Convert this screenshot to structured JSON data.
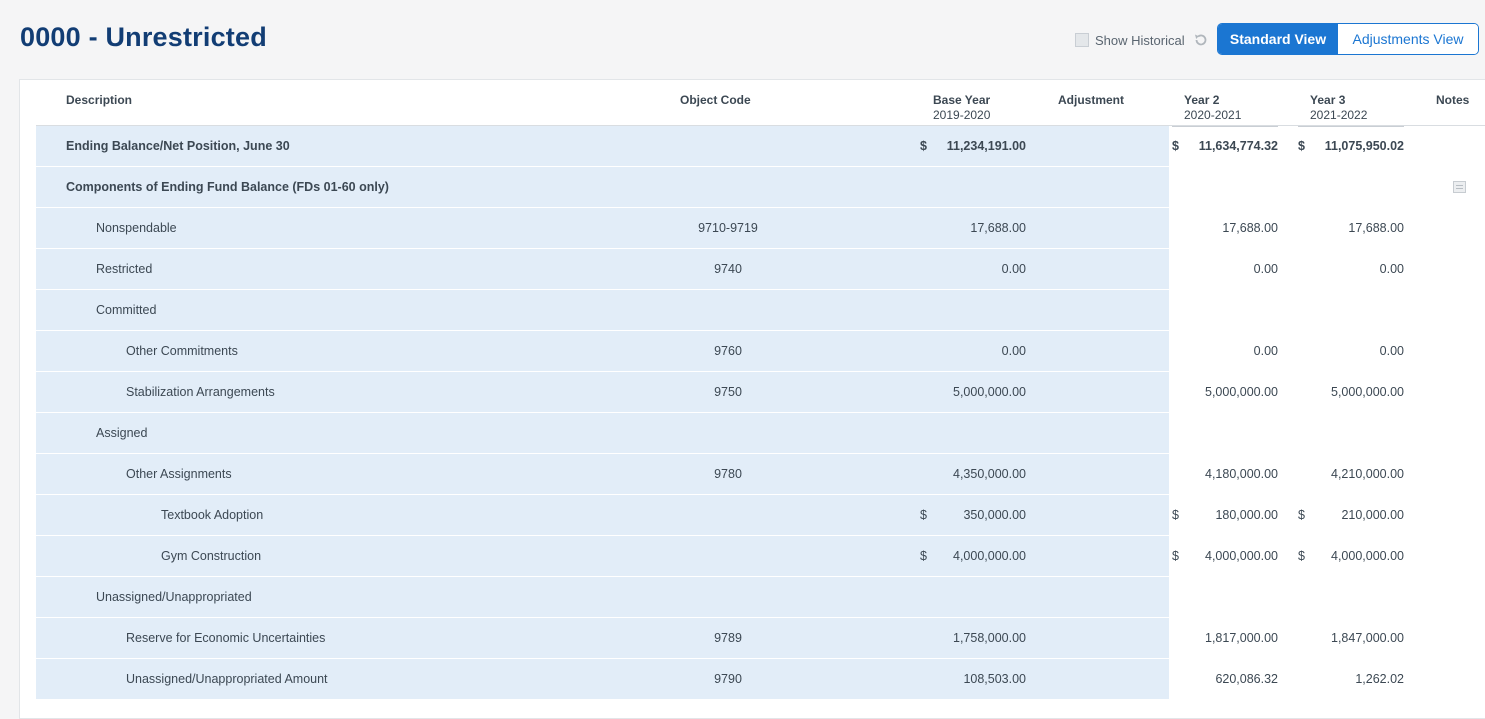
{
  "page": {
    "title": "0000 - Unrestricted"
  },
  "toolbar": {
    "show_historical_label": "Show Historical",
    "standard_view_label": "Standard View",
    "adjustments_view_label": "Adjustments View",
    "active_view": "Standard View"
  },
  "colors": {
    "accent": "#1b76d2",
    "title": "#123d74",
    "row_bg": "#e2edf8"
  },
  "table": {
    "headers": {
      "description": "Description",
      "object_code": "Object Code",
      "base_year": "Base Year",
      "base_year_range": "2019-2020",
      "adjustment": "Adjustment",
      "year2": "Year 2",
      "year2_range": "2020-2021",
      "year3": "Year 3",
      "year3_range": "2021-2022",
      "notes": "Notes"
    },
    "rows": [
      {
        "description": "Ending Balance/Net Position, June 30",
        "code": "",
        "base": "11,234,191.00",
        "year2": "11,634,774.32",
        "year3": "11,075,950.02",
        "dollar_base": "$",
        "dollar_y2": "$",
        "dollar_y3": "$"
      },
      {
        "description": "Components of Ending Fund Balance (FDs 01-60 only)",
        "code": "",
        "base": "",
        "year2": "",
        "year3": "",
        "dollar_base": "",
        "dollar_y2": "",
        "dollar_y3": ""
      },
      {
        "description": "Nonspendable",
        "code": "9710-9719",
        "base": "17,688.00",
        "year2": "17,688.00",
        "year3": "17,688.00",
        "dollar_base": "",
        "dollar_y2": "",
        "dollar_y3": ""
      },
      {
        "description": "Restricted",
        "code": "9740",
        "base": "0.00",
        "year2": "0.00",
        "year3": "0.00",
        "dollar_base": "",
        "dollar_y2": "",
        "dollar_y3": ""
      },
      {
        "description": "Committed",
        "code": "",
        "base": "",
        "year2": "",
        "year3": "",
        "dollar_base": "",
        "dollar_y2": "",
        "dollar_y3": ""
      },
      {
        "description": "Other Commitments",
        "code": "9760",
        "base": "0.00",
        "year2": "0.00",
        "year3": "0.00",
        "dollar_base": "",
        "dollar_y2": "",
        "dollar_y3": ""
      },
      {
        "description": "Stabilization Arrangements",
        "code": "9750",
        "base": "5,000,000.00",
        "year2": "5,000,000.00",
        "year3": "5,000,000.00",
        "dollar_base": "",
        "dollar_y2": "",
        "dollar_y3": ""
      },
      {
        "description": "Assigned",
        "code": "",
        "base": "",
        "year2": "",
        "year3": "",
        "dollar_base": "",
        "dollar_y2": "",
        "dollar_y3": ""
      },
      {
        "description": "Other Assignments",
        "code": "9780",
        "base": "4,350,000.00",
        "year2": "4,180,000.00",
        "year3": "4,210,000.00",
        "dollar_base": "",
        "dollar_y2": "",
        "dollar_y3": ""
      },
      {
        "description": "Textbook Adoption",
        "code": "",
        "base": "350,000.00",
        "year2": "180,000.00",
        "year3": "210,000.00",
        "dollar_base": "$",
        "dollar_y2": "$",
        "dollar_y3": "$"
      },
      {
        "description": "Gym Construction",
        "code": "",
        "base": "4,000,000.00",
        "year2": "4,000,000.00",
        "year3": "4,000,000.00",
        "dollar_base": "$",
        "dollar_y2": "$",
        "dollar_y3": "$"
      },
      {
        "description": "Unassigned/Unappropriated",
        "code": "",
        "base": "",
        "year2": "",
        "year3": "",
        "dollar_base": "",
        "dollar_y2": "",
        "dollar_y3": ""
      },
      {
        "description": "Reserve for Economic Uncertainties",
        "code": "9789",
        "base": "1,758,000.00",
        "year2": "1,817,000.00",
        "year3": "1,847,000.00",
        "dollar_base": "",
        "dollar_y2": "",
        "dollar_y3": ""
      },
      {
        "description": "Unassigned/Unappropriated Amount",
        "code": "9790",
        "base": "108,503.00",
        "year2": "620,086.32",
        "year3": "1,262.02",
        "dollar_base": "",
        "dollar_y2": "",
        "dollar_y3": ""
      }
    ]
  }
}
